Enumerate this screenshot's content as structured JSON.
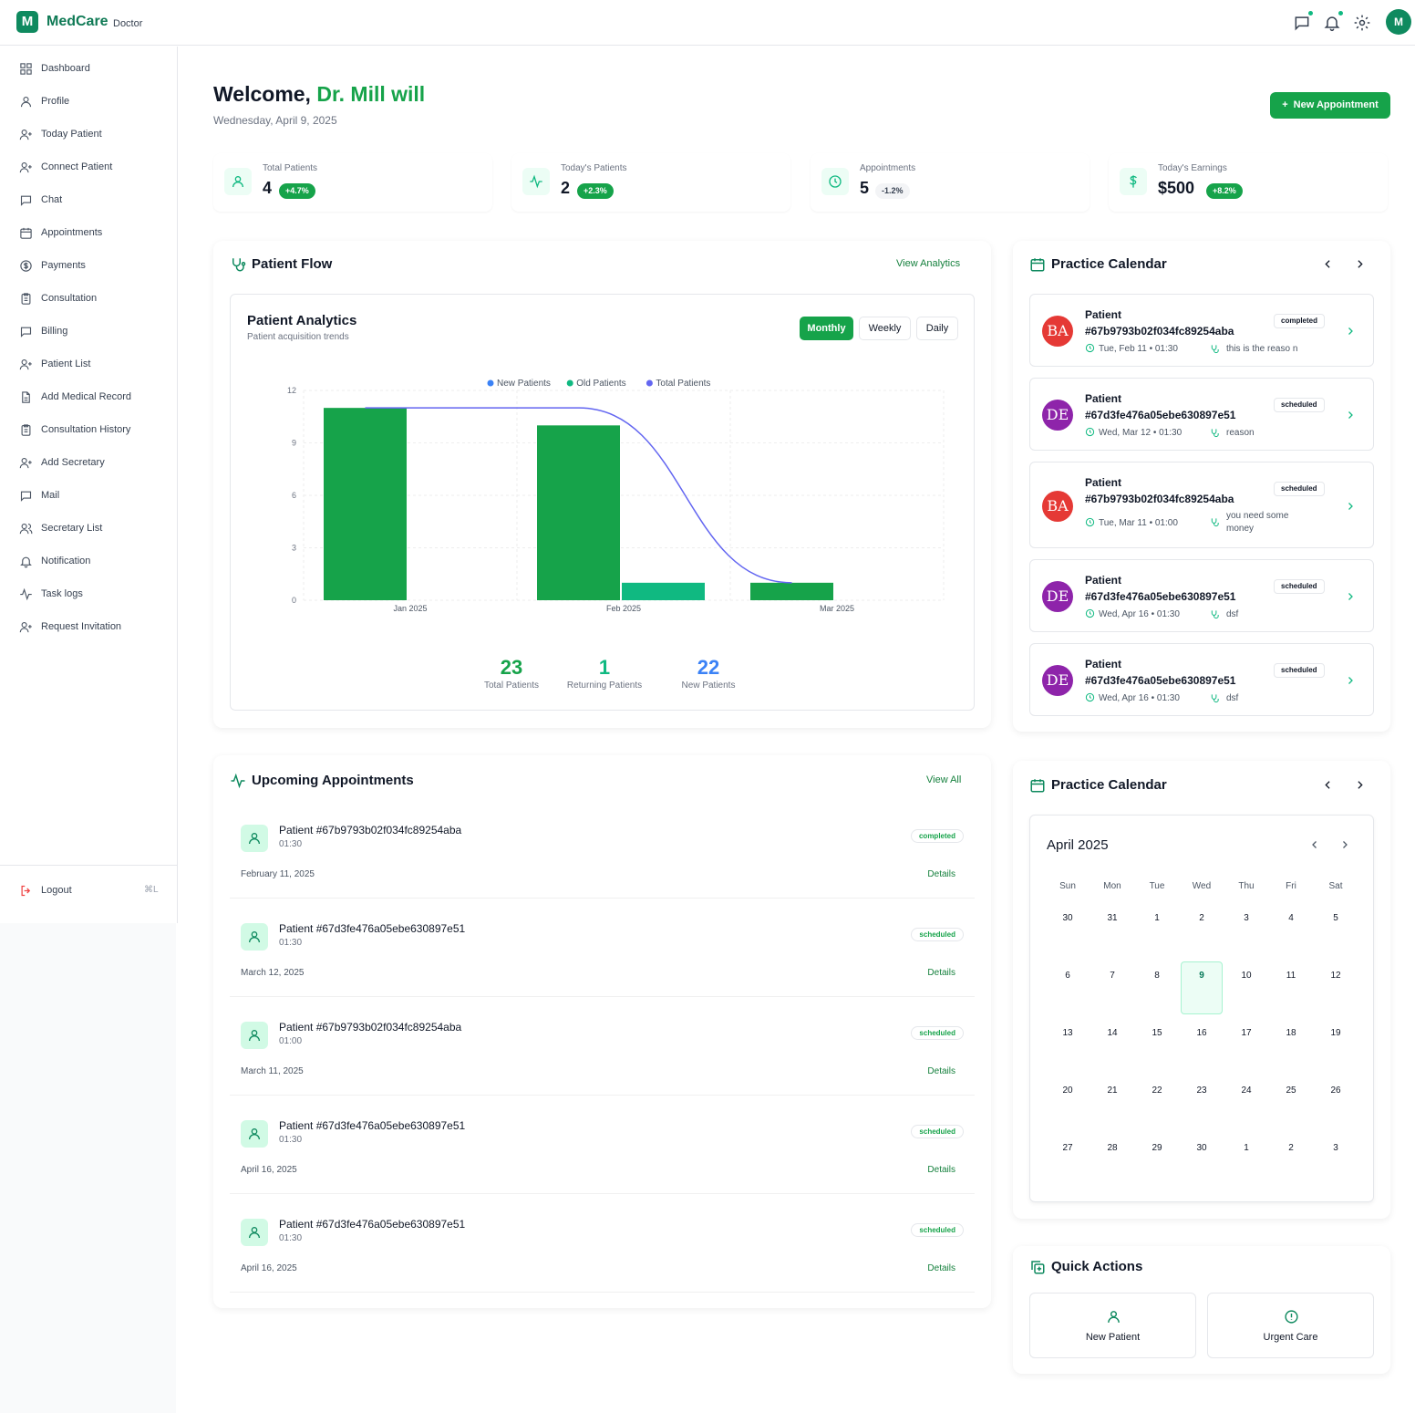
{
  "app": {
    "logo_letter": "M",
    "name": "MedCare",
    "role": "Doctor",
    "avatar_initial": "M"
  },
  "sidebar": {
    "items": [
      {
        "label": "Dashboard",
        "icon": "grid-icon"
      },
      {
        "label": "Profile",
        "icon": "user-icon"
      },
      {
        "label": "Today Patient",
        "icon": "user-plus-icon"
      },
      {
        "label": "Connect Patient",
        "icon": "user-plus-icon"
      },
      {
        "label": "Chat",
        "icon": "message-icon"
      },
      {
        "label": "Appointments",
        "icon": "calendar-icon"
      },
      {
        "label": "Payments",
        "icon": "dollar-circle-icon"
      },
      {
        "label": "Consultation",
        "icon": "clipboard-icon"
      },
      {
        "label": "Billing",
        "icon": "message-icon"
      },
      {
        "label": "Patient List",
        "icon": "user-plus-icon"
      },
      {
        "label": "Add Medical Record",
        "icon": "file-icon"
      },
      {
        "label": "Consultation History",
        "icon": "clipboard-icon"
      },
      {
        "label": "Add Secretary",
        "icon": "user-plus-icon"
      },
      {
        "label": "Mail",
        "icon": "message-icon"
      },
      {
        "label": "Secretary List",
        "icon": "users-icon"
      },
      {
        "label": "Notification",
        "icon": "bell-icon"
      },
      {
        "label": "Task logs",
        "icon": "activity-icon"
      },
      {
        "label": "Request Invitation",
        "icon": "user-plus-icon"
      }
    ],
    "logout": {
      "label": "Logout",
      "shortcut": "⌘L"
    }
  },
  "header": {
    "welcome_prefix": "Welcome,",
    "doctor_name": "Dr. Mill will",
    "date": "Wednesday, April 9, 2025",
    "new_appointment_label": "New Appointment"
  },
  "stats": [
    {
      "label": "Total Patients",
      "value": "4",
      "change": "+4.7%"
    },
    {
      "label": "Today's Patients",
      "value": "2",
      "change": "+2.3%"
    },
    {
      "label": "Appointments",
      "value": "5",
      "change": "-1.2%"
    },
    {
      "label": "Today's Earnings",
      "value": "$500",
      "change": "+8.2%"
    }
  ],
  "patient_flow": {
    "title": "Patient Flow",
    "link": "View Analytics",
    "analytics_title": "Patient Analytics",
    "analytics_subtitle": "Patient acquisition trends",
    "tabs": [
      "Monthly",
      "Weekly",
      "Daily"
    ],
    "summary": [
      {
        "value": "23",
        "label": "Total Patients",
        "color": "#16a34a"
      },
      {
        "value": "1",
        "label": "Returning Patients",
        "color": "#10b981"
      },
      {
        "value": "22",
        "label": "New Patients",
        "color": "#3b82f6"
      }
    ]
  },
  "chart_data": {
    "type": "bar",
    "categories": [
      "Jan 2025",
      "Feb 2025",
      "Mar 2025"
    ],
    "series": [
      {
        "name": "New Patients",
        "values": [
          11,
          10,
          1
        ],
        "color": "#16a34a"
      },
      {
        "name": "Old Patients",
        "values": [
          0,
          1,
          0
        ],
        "color": "#10b981"
      },
      {
        "name": "Total Patients",
        "values": [
          11,
          11,
          1
        ],
        "color": "#6366f1",
        "kind": "line"
      }
    ],
    "legend_colors": [
      "#3b82f6",
      "#10b981",
      "#6366f1"
    ],
    "yticks": [
      "0",
      "3",
      "6",
      "9",
      "12"
    ],
    "ylim": [
      0,
      12
    ],
    "legend": "top-center"
  },
  "upcoming": {
    "title": "Upcoming Appointments",
    "link": "View All",
    "details_label": "Details",
    "items": [
      {
        "name": "Patient #67b9793b02f034fc89254aba",
        "time": "01:30",
        "date": "February 11, 2025",
        "status": "completed"
      },
      {
        "name": "Patient #67d3fe476a05ebe630897e51",
        "time": "01:30",
        "date": "March 12, 2025",
        "status": "scheduled"
      },
      {
        "name": "Patient #67b9793b02f034fc89254aba",
        "time": "01:00",
        "date": "March 11, 2025",
        "status": "scheduled"
      },
      {
        "name": "Patient #67d3fe476a05ebe630897e51",
        "time": "01:30",
        "date": "April 16, 2025",
        "status": "scheduled"
      },
      {
        "name": "Patient #67d3fe476a05ebe630897e51",
        "time": "01:30",
        "date": "April 16, 2025",
        "status": "scheduled"
      }
    ]
  },
  "practice_calendar": {
    "title": "Practice Calendar",
    "appointments": [
      {
        "initials": "BA",
        "color": "#e53935",
        "line1": "Patient",
        "line2": "#67b9793b02f034fc89254aba",
        "when": "Tue, Feb 11 • 01:30",
        "reason": "this is the reaso n",
        "status": "completed"
      },
      {
        "initials": "DE",
        "color": "#8e24aa",
        "line1": "Patient",
        "line2": "#67d3fe476a05ebe630897e51",
        "when": "Wed, Mar 12 • 01:30",
        "reason": "reason",
        "status": "scheduled"
      },
      {
        "initials": "BA",
        "color": "#e53935",
        "line1": "Patient",
        "line2": "#67b9793b02f034fc89254aba",
        "when": "Tue, Mar 11 • 01:00",
        "reason": "you need some money",
        "status": "scheduled"
      },
      {
        "initials": "DE",
        "color": "#8e24aa",
        "line1": "Patient",
        "line2": "#67d3fe476a05ebe630897e51",
        "when": "Wed, Apr 16 • 01:30",
        "reason": "dsf",
        "status": "scheduled"
      },
      {
        "initials": "DE",
        "color": "#8e24aa",
        "line1": "Patient",
        "line2": "#67d3fe476a05ebe630897e51",
        "when": "Wed, Apr 16 • 01:30",
        "reason": "dsf",
        "status": "scheduled"
      }
    ]
  },
  "month_calendar": {
    "title": "Practice Calendar",
    "month_label": "April 2025",
    "weekdays": [
      "Sun",
      "Mon",
      "Tue",
      "Wed",
      "Thu",
      "Fri",
      "Sat"
    ],
    "days": [
      "30",
      "31",
      "1",
      "2",
      "3",
      "4",
      "5",
      "6",
      "7",
      "8",
      "9",
      "10",
      "11",
      "12",
      "13",
      "14",
      "15",
      "16",
      "17",
      "18",
      "19",
      "20",
      "21",
      "22",
      "23",
      "24",
      "25",
      "26",
      "27",
      "28",
      "29",
      "30",
      "1",
      "2",
      "3"
    ],
    "today_index": 10
  },
  "quick_actions": {
    "title": "Quick Actions",
    "items": [
      {
        "label": "New Patient",
        "icon": "user-icon"
      },
      {
        "label": "Urgent Care",
        "icon": "alert-circle-icon"
      }
    ]
  }
}
